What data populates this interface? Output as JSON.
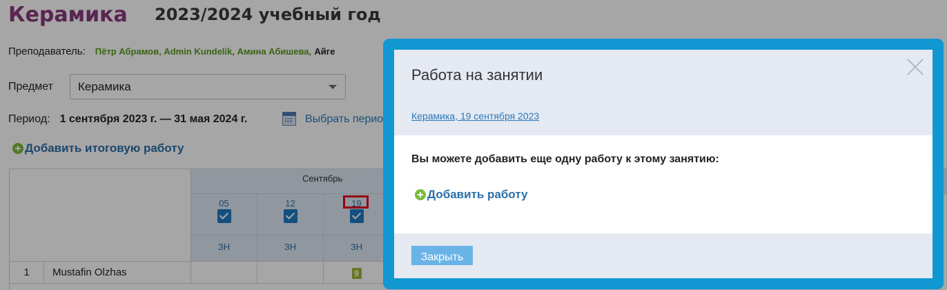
{
  "page": {
    "title": "Керамика",
    "year": "2023/2024 учебный год",
    "teachers_label": "Преподаватель:",
    "teachers_names": "Пётр Абрамов, Admin Kundelik, Амина Абишева,",
    "teachers_more": "Айге",
    "subject_label": "Предмет",
    "subject_value": "Керамика",
    "period_label": "Период:",
    "period_dates": "1 сентября 2023 г. — 31 мая 2024 г.",
    "choose_period": "Выбрать перио",
    "add_final_work": "Добавить итоговую работу"
  },
  "journal": {
    "month": "Сентябрь",
    "days": [
      {
        "day": "05",
        "type": "ЗН"
      },
      {
        "day": "12",
        "type": "ЗН"
      },
      {
        "day": "19",
        "type": "ЗН"
      }
    ],
    "rows": [
      {
        "num": "1",
        "name": "Mustafin Olzhas",
        "grades": [
          "",
          "",
          "9"
        ]
      }
    ]
  },
  "modal": {
    "title": "Работа на занятии",
    "lesson_link": "Керамика, 19 сентября 2023",
    "message": "Вы можете добавить еще одну работу к этому занятию:",
    "add_work": "Добавить работу",
    "close_button": "Закрыть"
  },
  "colors": {
    "modal_border": "#1197d2",
    "subject_title": "#8a3a7e",
    "teacher_names": "#5a9b1e",
    "link": "#2a78b8",
    "checkbox": "#1f7ac2",
    "grade_badge": "#a3b23a",
    "highlight": "#e4001b"
  }
}
